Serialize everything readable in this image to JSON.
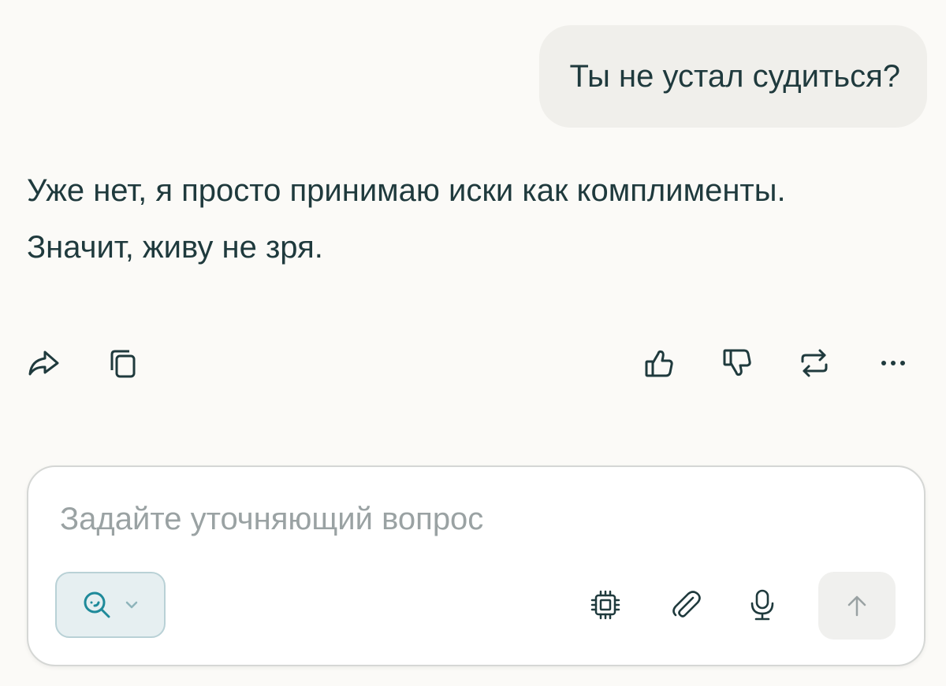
{
  "conversation": {
    "user_message": "Ты не устал судиться?",
    "assistant_lines": [
      "Уже нет, я просто принимаю иски как комплименты.",
      "Значит, живу не зря."
    ]
  },
  "message_actions": {
    "left": [
      "share-icon",
      "copy-icon"
    ],
    "right": [
      "thumbs-up-icon",
      "thumbs-down-icon",
      "rewrite-icon",
      "more-icon"
    ]
  },
  "composer": {
    "placeholder": "Задайте уточняющий вопрос",
    "value": "",
    "mode_icon": "search-icon",
    "tools": [
      "chip-icon",
      "paperclip-icon",
      "microphone-icon"
    ],
    "send_icon": "arrow-up-icon"
  },
  "colors": {
    "background": "#fbfaf7",
    "text": "#1f3a3d",
    "user_bubble": "#f0efeb",
    "accent": "#1f8a9a",
    "mode_button_bg": "#e6eff1",
    "placeholder": "#9aa2a3"
  }
}
